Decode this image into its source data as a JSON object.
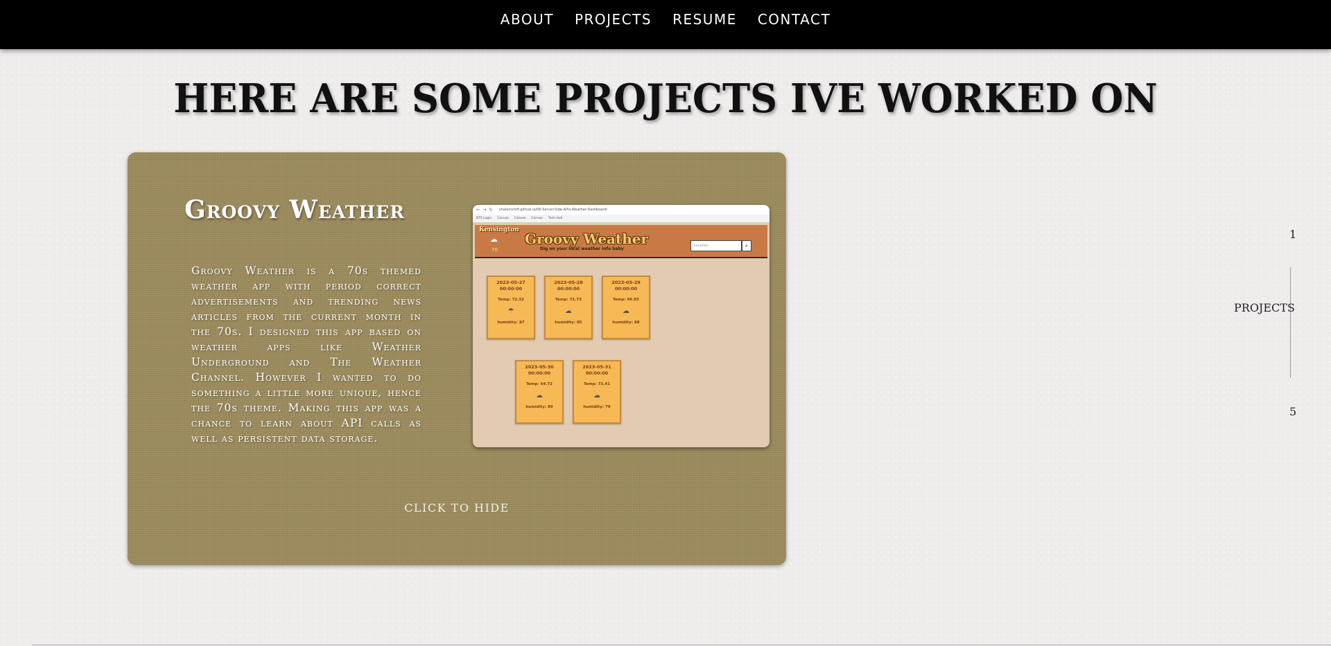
{
  "nav": {
    "items": [
      {
        "label": "ABOUT"
      },
      {
        "label": "PROJECTS"
      },
      {
        "label": "RESUME"
      },
      {
        "label": "CONTACT"
      }
    ]
  },
  "heading": "HERE ARE SOME PROJECTS IVE WORKED ON",
  "project": {
    "title": "Groovy Weather",
    "description": "Groovy Weather is a 70s themed weather app with period correct advertisements and trending news articles from the current month in the 70s. I designed this app based on weather apps like Weather Underground and The Weather Channel. However I wanted to do something a little more unique, hence the 70s theme. Making this app was a chance to learn about API calls as well as persistent data storage.",
    "hide_label": "CLICK TO HIDE",
    "screenshot": {
      "url": "shalomshiff.github.io/06-Server-Side-APIs-Weather-Dashboard/",
      "bookmarks": [
        "BTS Login",
        "Canvas",
        "Canvas",
        "Canvas",
        "Tech Hub"
      ],
      "location": "Kensington",
      "current_temp": "70",
      "app_title": "Groovy Weather",
      "app_subtitle": "Dig on your local weather info baby",
      "search_placeholder": "Location",
      "forecast": [
        {
          "date": "2023-05-27",
          "time": "00:00:00",
          "temp": "Temp: 72.32",
          "icon": "☂",
          "humidity": "humidity: 87"
        },
        {
          "date": "2023-05-28",
          "time": "00:00:00",
          "temp": "Temp: 71.73",
          "icon": "☁",
          "humidity": "humidity: 85"
        },
        {
          "date": "2023-05-29",
          "time": "00:00:00",
          "temp": "Temp: 66.85",
          "icon": "☁",
          "humidity": "humidity: 88"
        },
        {
          "date": "2023-05-30",
          "time": "00:00:00",
          "temp": "Temp: 64.72",
          "icon": "☁",
          "humidity": "humidity: 89"
        },
        {
          "date": "2023-05-31",
          "time": "00:00:00",
          "temp": "Temp: 73.41",
          "icon": "☁",
          "humidity": "humidity: 79"
        }
      ]
    }
  },
  "side_indicator": {
    "top": "1",
    "label": "PROJECTS",
    "bottom": "5"
  }
}
